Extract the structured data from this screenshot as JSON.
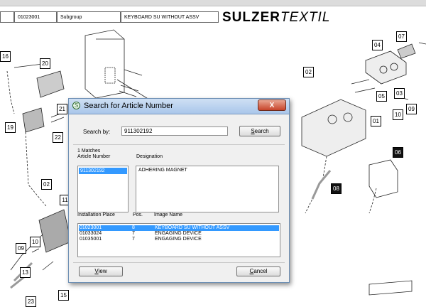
{
  "header": {
    "code": "01023001",
    "kind": "Subgroup",
    "description": "KEYBOARD SU WITHOUT ASSV",
    "brand_bold": "SULZER",
    "brand_italic": "TEXTIL"
  },
  "callouts": [
    "16",
    "20",
    "19",
    "21",
    "22",
    "02",
    "11",
    "10",
    "09",
    "13",
    "23",
    "15",
    "07",
    "04",
    "02",
    "05",
    "03",
    "10",
    "09",
    "01",
    "06",
    "08"
  ],
  "dialog": {
    "title": "Search for Article Number",
    "close_label": "X",
    "search_by_label": "Search by:",
    "search_value": "911302192",
    "search_button_pre": "",
    "search_button_u": "S",
    "search_button_post": "earch",
    "matches_label": "1 Matches",
    "article_number_header": "Article Number",
    "designation_header": "Designation",
    "article_numbers": [
      "911302192"
    ],
    "designation_value": "ADHERING MAGNET",
    "installation": {
      "headers": [
        "Installation Place",
        "Pos.",
        "Image Name"
      ],
      "rows": [
        {
          "place": "01023001",
          "pos": "8",
          "image": "KEYBOARD SU WITHOUT ASSV"
        },
        {
          "place": "01033024",
          "pos": "7",
          "image": "ENGAGING DEVICE"
        },
        {
          "place": "01035001",
          "pos": "7",
          "image": "ENGAGING DEVICE"
        }
      ]
    },
    "view_button_u": "V",
    "view_button_post": "iew",
    "cancel_button_u": "C",
    "cancel_button_post": "ancel"
  },
  "colors": {
    "selection": "#3399ff",
    "titlebar": "#a9c6ea",
    "close": "#c7432a"
  }
}
